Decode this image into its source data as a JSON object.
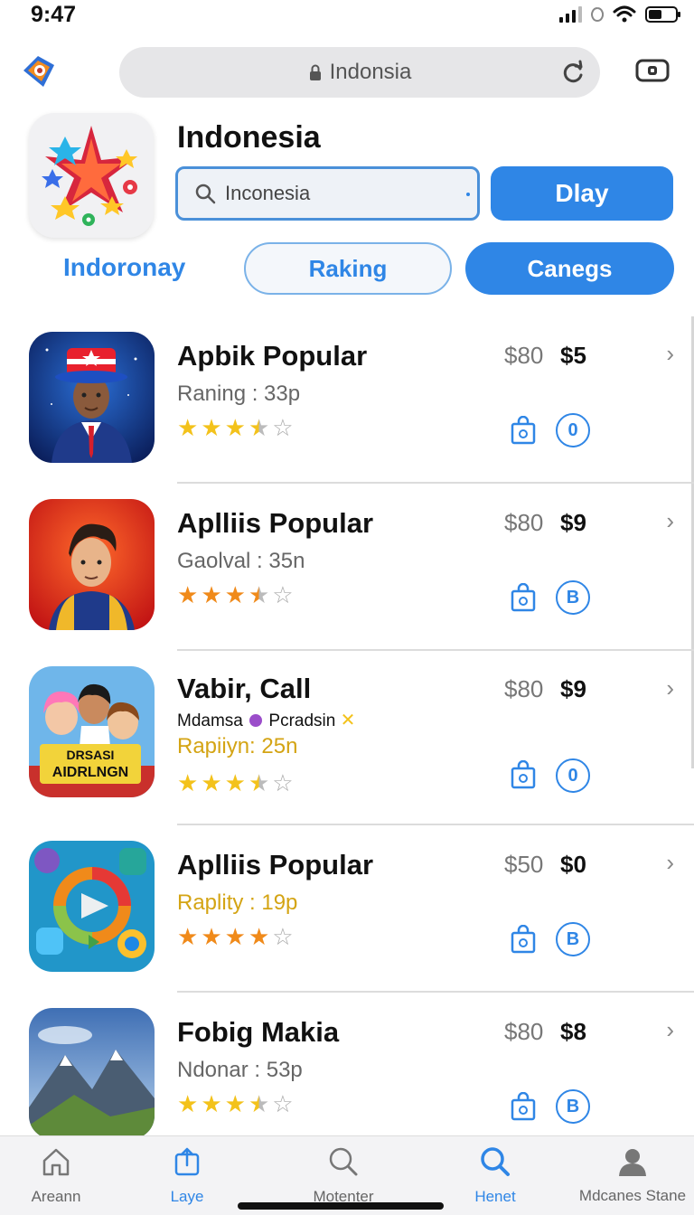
{
  "status": {
    "time": "9:47"
  },
  "browser": {
    "url": "Indonsia"
  },
  "header": {
    "title": "Indonesia",
    "search_value": "Inconesia",
    "play_label": "Dlay"
  },
  "filters": {
    "label": "Indoronay",
    "ranking": "Raking",
    "categories": "Canegs"
  },
  "apps": [
    {
      "title": "Apbik Popular",
      "sub": "Raning : 33p",
      "sub_style": "gray",
      "rating": 3.5,
      "price_old": "$80",
      "price_new": "$5",
      "coin": "0"
    },
    {
      "title": "Aplliis Popular",
      "sub": "Gaolval : 35n",
      "sub_style": "gray",
      "rating": 3.5,
      "price_old": "$80",
      "price_new": "$9",
      "coin": "B"
    },
    {
      "title": "Vabir, Call",
      "meta": "Mdamsa",
      "meta2": "Pcradsin",
      "sub": "Rapiiyn: 25n",
      "sub_style": "gold",
      "rating": 3.5,
      "price_old": "$80",
      "price_new": "$9",
      "coin": "0"
    },
    {
      "title": "Aplliis Popular",
      "sub": "Raplity : 19p",
      "sub_style": "gold",
      "rating": 4,
      "price_old": "$50",
      "price_new": "$0",
      "coin": "B"
    },
    {
      "title": "Fobig Makia",
      "sub": "Ndonar : 53p",
      "sub_style": "gray",
      "rating": 3.5,
      "price_old": "$80",
      "price_new": "$8",
      "coin": "B"
    }
  ],
  "thumb_text": {
    "app3_line1": "DRSASI",
    "app3_line2": "AIDRLNGN"
  },
  "tabbar": [
    {
      "label": "Areann",
      "icon": "home-icon",
      "active": false
    },
    {
      "label": "Laye",
      "icon": "share-icon",
      "active": true
    },
    {
      "label": "Motenter",
      "icon": "search-icon",
      "active": false
    },
    {
      "label": "Henet",
      "icon": "search-icon",
      "active": true
    },
    {
      "label": "Mdcanes Stane",
      "icon": "profile-icon",
      "active": false
    }
  ],
  "colors": {
    "accent": "#2f86e6",
    "star_gold": "#f3c21b",
    "star_orange": "#f08a1a"
  }
}
